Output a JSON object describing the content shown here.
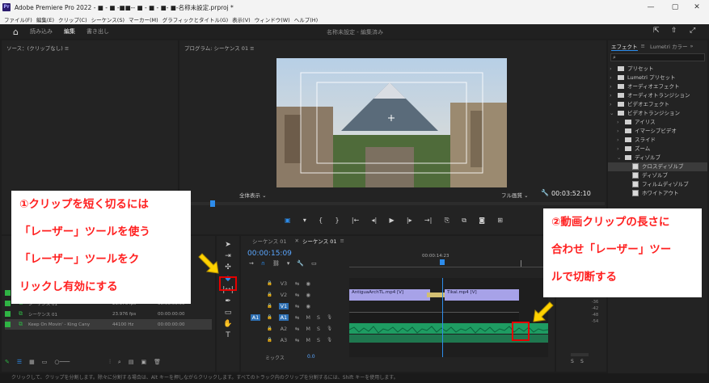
{
  "window": {
    "title": "Adobe Premiere Pro 2022 - ■ ‐ ■ ‐■■‐‐ ■ ‐ ■ ‐ ■‐ ■‐名称未設定.prproj *",
    "icon": "Pr"
  },
  "menu": [
    "ファイル(F)",
    "編集(E)",
    "クリップ(C)",
    "シーケンス(S)",
    "マーカー(M)",
    "グラフィックとタイトル(G)",
    "表示(V)",
    "ウィンドウ(W)",
    "ヘルプ(H)"
  ],
  "workspaces": {
    "home_icon": "home-icon",
    "items": [
      "読み込み",
      "編集",
      "書き出し"
    ],
    "active": "編集",
    "project_status": "名称未設定 - 編集済み"
  },
  "source_panel": {
    "title": "ソース：(クリップなし)"
  },
  "program_panel": {
    "title": "プログラム: シーケンス 01",
    "timecode": "00:00:15:09",
    "zoom": "全体表示",
    "quality": "フル画質",
    "duration": "00:03:52:10"
  },
  "effects_panel": {
    "tabs": [
      "エフェクト",
      "Lumetri カラー"
    ],
    "items": [
      {
        "label": "プリセット",
        "level": 0,
        "kind": "folder",
        "open": false
      },
      {
        "label": "Lumetri プリセット",
        "level": 0,
        "kind": "folder",
        "open": false
      },
      {
        "label": "オーディオエフェクト",
        "level": 0,
        "kind": "folder",
        "open": false
      },
      {
        "label": "オーディオトランジション",
        "level": 0,
        "kind": "folder",
        "open": false
      },
      {
        "label": "ビデオエフェクト",
        "level": 0,
        "kind": "folder",
        "open": false
      },
      {
        "label": "ビデオトランジション",
        "level": 0,
        "kind": "folder",
        "open": true
      },
      {
        "label": "アイリス",
        "level": 1,
        "kind": "folder",
        "open": false
      },
      {
        "label": "イマーシブビデオ",
        "level": 1,
        "kind": "folder",
        "open": false
      },
      {
        "label": "スライド",
        "level": 1,
        "kind": "folder",
        "open": false
      },
      {
        "label": "ズーム",
        "level": 1,
        "kind": "folder",
        "open": false
      },
      {
        "label": "ディゾルブ",
        "level": 1,
        "kind": "folder",
        "open": true
      },
      {
        "label": "クロスディゾルブ",
        "level": 2,
        "kind": "transition",
        "selected": true
      },
      {
        "label": "ディゾルブ",
        "level": 2,
        "kind": "transition"
      },
      {
        "label": "フィルムディゾルブ",
        "level": 2,
        "kind": "transition"
      },
      {
        "label": "ホワイトアウト",
        "level": 2,
        "kind": "transition"
      }
    ]
  },
  "project_panel": {
    "rows": [
      {
        "name": "Tikal.mp4",
        "fps": "",
        "start": "00:00:00:00",
        "color": "#2fb344"
      },
      {
        "name": "シーケンス 01",
        "fps": "23.976 fps",
        "start": "00:00:00:00",
        "color": "#2fb344"
      },
      {
        "name": "シーケンス 01",
        "fps": "23.976 fps",
        "start": "00:00:00:00",
        "color": "#2fb344"
      },
      {
        "name": "Keep On Movin' - King Cany",
        "fps": "44100 Hz",
        "start": "00:00:00:00",
        "color": "#2fb344"
      }
    ]
  },
  "timeline": {
    "tabs": [
      "シーケンス 01",
      "シーケンス 01"
    ],
    "timecode": "00:00:15:09",
    "ruler_time": "00:00:14:23",
    "tracks": [
      {
        "name": "V3",
        "type": "video"
      },
      {
        "name": "V2",
        "type": "video"
      },
      {
        "name": "V1",
        "type": "video",
        "source": ""
      },
      {
        "name": "A1",
        "type": "audio",
        "source": "A1"
      },
      {
        "name": "A2",
        "type": "audio"
      },
      {
        "name": "A3",
        "type": "audio"
      }
    ],
    "mix_label": "ミックス",
    "mix_value": "0.0",
    "clips": [
      {
        "label": "AntiguaArchTL.mp4 [V]",
        "track": "V2"
      },
      {
        "label": "Tikal.mp4 [V]",
        "track": "V2"
      }
    ]
  },
  "audio_meter": {
    "labels": [
      "-36",
      "-42",
      "-48",
      "-54",
      "dB"
    ],
    "footer": [
      "S",
      "S"
    ]
  },
  "callouts": {
    "left": [
      "①クリップを短く切るには",
      "「レーザー」ツールを使う",
      "「レーザー」ツールをク",
      "リックし有効にする"
    ],
    "right": [
      "②動画クリップの長さに",
      "合わせ「レーザー」ツー",
      "ルで切断する"
    ]
  },
  "status_text": "クリックして、クリップを分割します。除々に分割する場合は、Alt キーを押しながらクリックします。すべてのトラック内のクリップを分割するには、Shift キーを使用します。",
  "colors": {
    "accent_blue": "#2d8ceb",
    "timecode_blue": "#5aa7ff",
    "callout_red": "#ff2020",
    "arrow_yellow": "#ffd200",
    "clip_purple": "#a7a2e8",
    "audio_green": "#1fb36f"
  }
}
